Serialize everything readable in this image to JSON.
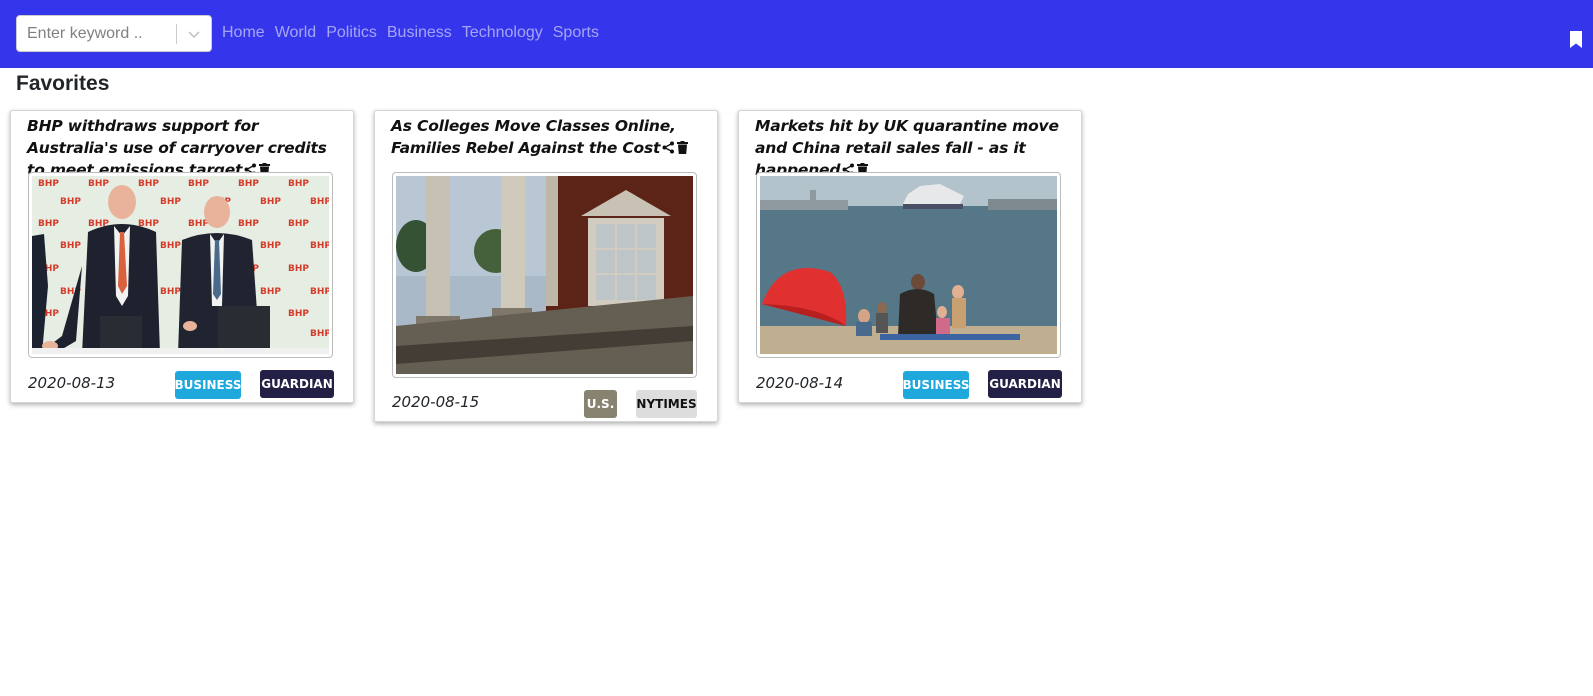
{
  "navbar": {
    "search_placeholder": "Enter keyword ..",
    "links": [
      "Home",
      "World",
      "Politics",
      "Business",
      "Technology",
      "Sports"
    ],
    "background": "#3535ec",
    "bookmark_icon": "bookmark-icon"
  },
  "page_title": "Favorites",
  "cards": [
    {
      "title": "BHP withdraws support for Australia's use of carryover credits to meet emissions target",
      "date": "2020-08-13",
      "section": "BUSINESS",
      "source": "GUARDIAN",
      "section_color": "#1ea8dc",
      "source_color": "#222044",
      "image": "two men in suits in front of BHP backdrop"
    },
    {
      "title": "As Colleges Move Classes Online, Families Rebel Against the Cost",
      "date": "2020-08-15",
      "section": "U.S.",
      "source": "NYTIMES",
      "section_color": "#888270",
      "source_color": "#dddddd",
      "image": "college building portico with columns"
    },
    {
      "title": "Markets hit by UK quarantine move and China retail sales fall - as it happened",
      "date": "2020-08-14",
      "section": "BUSINESS",
      "source": "GUARDIAN",
      "section_color": "#1ea8dc",
      "source_color": "#222044",
      "image": "beach with red umbrella and ferry on sea"
    }
  ]
}
